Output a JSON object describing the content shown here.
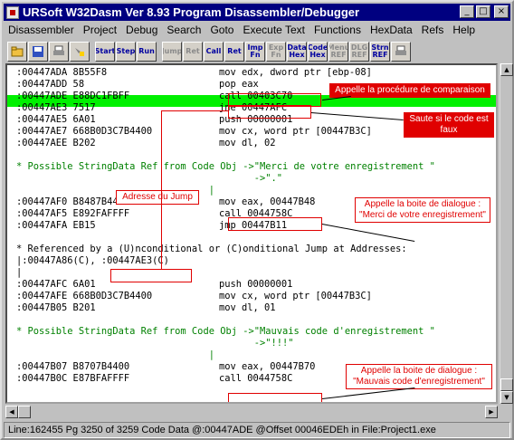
{
  "window": {
    "title": "URSoft W32Dasm Ver 8.93 Program Disassembler/Debugger",
    "min_label": "_",
    "max_label": "□",
    "close_label": "×"
  },
  "menu": [
    "Disassembler",
    "Project",
    "Debug",
    "Search",
    "Goto",
    "Execute Text",
    "Functions",
    "HexData",
    "Refs",
    "Help"
  ],
  "toolbar": {
    "buttons": [
      "Start",
      "Step",
      "Run",
      "Jump",
      "Ret",
      "Call",
      "Ret",
      "Imp Fn",
      "Exp Fn",
      "Data Hex",
      "Code Hex",
      "Menu REF",
      "DLG REF",
      "Strn REF"
    ]
  },
  "code": {
    "lines": [
      {
        "addr": ":00447ADA 8B55F8",
        "instr": "mov edx, dword ptr [ebp-08]"
      },
      {
        "addr": ":00447ADD 58",
        "instr": "pop eax"
      },
      {
        "addr": ":00447ADE E88DC1FBFF",
        "instr": "call 00403C70",
        "highlight": true
      },
      {
        "addr": ":00447AE3 7517",
        "instr": "jne 00447AFC"
      },
      {
        "addr": ":00447AE5 6A01",
        "instr": "push 00000001"
      },
      {
        "addr": ":00447AE7 668B0D3C7B4400",
        "instr": "mov cx, word ptr [00447B3C]"
      },
      {
        "addr": ":00447AEE B202",
        "instr": "mov dl, 02"
      },
      {
        "text": ""
      },
      {
        "text": "* Possible StringData Ref from Code Obj ->\"Merci de votre enregistrement \"",
        "green": true
      },
      {
        "text": "                                          ->\".\"",
        "green": true
      },
      {
        "text": "                                  |",
        "green": true
      },
      {
        "addr": ":00447AF0 B8487B4400",
        "instr": "mov eax, 00447B48"
      },
      {
        "addr": ":00447AF5 E892FAFFFF",
        "instr": "call 0044758C"
      },
      {
        "addr": ":00447AFA EB15",
        "instr": "jmp 00447B11"
      },
      {
        "text": ""
      },
      {
        "text": "* Referenced by a (U)nconditional or (C)onditional Jump at Addresses:"
      },
      {
        "text": "|:00447A86(C), :00447AE3(C)"
      },
      {
        "text": "|"
      },
      {
        "addr": ":00447AFC 6A01",
        "instr": "push 00000001"
      },
      {
        "addr": ":00447AFE 668B0D3C7B4400",
        "instr": "mov cx, word ptr [00447B3C]"
      },
      {
        "addr": ":00447B05 B201",
        "instr": "mov dl, 01"
      },
      {
        "text": ""
      },
      {
        "text": "* Possible StringData Ref from Code Obj ->\"Mauvais code d'enregistrement \"",
        "green": true
      },
      {
        "text": "                                          ->\"!!!\"",
        "green": true
      },
      {
        "text": "                                  |",
        "green": true
      },
      {
        "addr": ":00447B07 B8707B4400",
        "instr": "mov eax, 00447B70"
      },
      {
        "addr": ":00447B0C E87BFAFFFF",
        "instr": "call 0044758C"
      }
    ]
  },
  "annotations": {
    "compare": "Appelle la procédure de comparaison",
    "jump_fail": "Saute si le code est faux",
    "jump_addr": "Adresse du Jump",
    "dialog_ok": "Appelle la boite de dialogue : \"Merci de votre enregistrement\"",
    "dialog_bad": "Appelle la boite de dialogue : \"Mauvais code d'enregistrement\""
  },
  "status": "Line:162455 Pg 3250 of 3259  Code Data @:00447ADE @Offset 00046EDEh in File:Project1.exe",
  "colors": {
    "highlight": "#00f000",
    "annotation": "#e00000",
    "string_ref": "#008000",
    "titlebar": "#000080"
  }
}
